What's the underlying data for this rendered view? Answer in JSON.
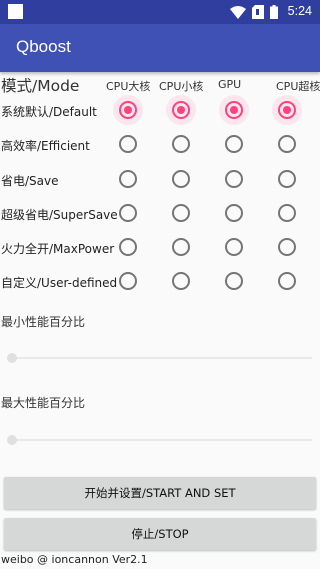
{
  "status_bar": {
    "time": "5:24",
    "icons": [
      "wifi-icon",
      "sim-no-signal-icon",
      "battery-icon"
    ]
  },
  "app_bar": {
    "title": "Qboost"
  },
  "mode_table": {
    "header": "模式/Mode",
    "columns": [
      "CPU大核",
      "CPU小核",
      "GPU",
      "CPU超核"
    ],
    "rows": [
      {
        "label": "系统默认/Default",
        "checked": [
          true,
          true,
          true,
          true
        ]
      },
      {
        "label": "高效率/Efficient",
        "checked": [
          false,
          false,
          false,
          false
        ]
      },
      {
        "label": "省电/Save",
        "checked": [
          false,
          false,
          false,
          false
        ]
      },
      {
        "label": "超级省电/SuperSave",
        "checked": [
          false,
          false,
          false,
          false
        ]
      },
      {
        "label": "火力全开/MaxPower",
        "checked": [
          false,
          false,
          false,
          false
        ]
      },
      {
        "label": "自定义/User-defined",
        "checked": [
          false,
          false,
          false,
          false
        ]
      }
    ]
  },
  "min_perf": {
    "label": "最小性能百分比",
    "value_percent": 0
  },
  "max_perf": {
    "label": "最大性能百分比",
    "value_percent": 0
  },
  "buttons": {
    "start": "开始并设置/START AND SET",
    "stop": "停止/STOP"
  },
  "footer": "weibo @ ioncannon Ver2.1",
  "colors": {
    "status_bar": "#303f9f",
    "app_bar": "#3f51b5",
    "accent": "#ff4081",
    "radio_unchecked": "#757575",
    "button": "#d6d7d7"
  }
}
